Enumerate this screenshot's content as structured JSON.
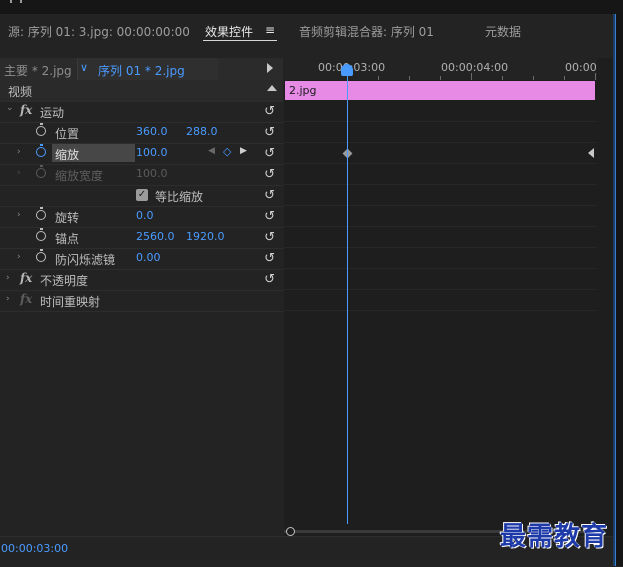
{
  "tabs": {
    "source": "源: 序列 01: 3.jpg: 00:00:00:00",
    "effect_controls": "效果控件",
    "menu_glyph": "≡",
    "audio_mixer": "音频剪辑混合器: 序列 01",
    "metadata": "元数据"
  },
  "sequence_bar": {
    "master": "主要 * 2.jpg",
    "chevron": "∨",
    "sequence": "序列 01 * 2.jpg"
  },
  "section": {
    "video": "视频"
  },
  "effects": {
    "motion": {
      "name": "运动",
      "position": {
        "label": "位置",
        "x": "360.0",
        "y": "288.0"
      },
      "scale": {
        "label": "缩放",
        "value": "100.0"
      },
      "scale_width": {
        "label": "缩放宽度",
        "value": "100.0"
      },
      "uniform_scale": {
        "label": "等比缩放",
        "checked": true
      },
      "rotation": {
        "label": "旋转",
        "value": "0.0"
      },
      "anchor": {
        "label": "锚点",
        "x": "2560.0",
        "y": "1920.0"
      },
      "antiflicker": {
        "label": "防闪烁滤镜",
        "value": "0.00"
      }
    },
    "opacity": {
      "name": "不透明度"
    },
    "time_remap": {
      "name": "时间重映射"
    }
  },
  "icons": {
    "reset": "↺",
    "fx": "fx",
    "expand": "›",
    "collapse": "⌄",
    "prev_keyframe": "◀",
    "next_keyframe": "▶",
    "add_keyframe": "◇"
  },
  "timeline": {
    "labels": [
      "00:00:03:00",
      "00:00:04:00",
      "00:00"
    ],
    "clip_name": "2.jpg"
  },
  "footer": {
    "current_time": "00:00:03:00",
    "watermark": "最需教育"
  },
  "colors": {
    "accent": "#4a9bff",
    "clip": "#e68ae6",
    "background": "#232323"
  }
}
